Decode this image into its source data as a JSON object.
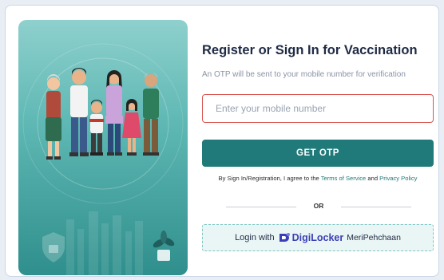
{
  "form": {
    "title": "Register or Sign In for Vaccination",
    "subtitle": "An OTP will be sent to your mobile number for verification",
    "mobile_placeholder": "Enter your mobile number",
    "mobile_value": "",
    "otp_button_label": "GET OTP",
    "agree_prefix": "By Sign In/Registration, I agree to the ",
    "terms_label": "Terms of Service",
    "agree_and": " and ",
    "privacy_label": "Privacy Policy",
    "or_label": "OR",
    "digilocker": {
      "prefix": "Login with",
      "brand": "DigiLocker",
      "tagline": "MeriPehchaan"
    }
  },
  "colors": {
    "primary": "#1f7a79",
    "input_error_border": "#d9534f",
    "digilocker_brand": "#3b3fb6",
    "panel_top": "#8ed0cd",
    "panel_bottom": "#2f8f8c"
  },
  "icons": [
    "family-illustration",
    "shield-icon",
    "plant-icon",
    "digilocker-logo-icon"
  ]
}
